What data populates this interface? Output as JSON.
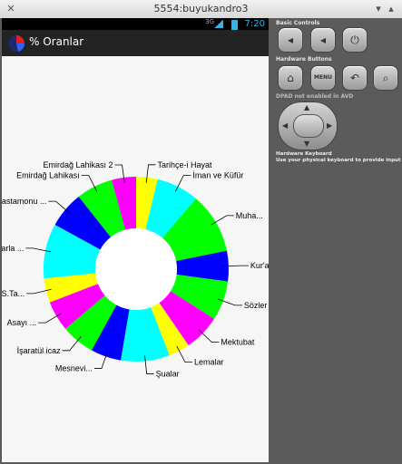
{
  "window": {
    "title": "5554:buyukandro3"
  },
  "statusbar": {
    "network": "3G",
    "time": "7:20"
  },
  "actionbar": {
    "title": "% Oranlar"
  },
  "chart_data": {
    "type": "pie",
    "donut": true,
    "slices": [
      {
        "label": "Tarihçe-i Hayat",
        "value": 3.5,
        "color": "#ffff00"
      },
      {
        "label": "İman ve Küfür",
        "value": 7,
        "color": "#00ffff"
      },
      {
        "label": "Muha...",
        "value": 10,
        "color": "#00ff00"
      },
      {
        "label": "Kur'a...",
        "value": 5,
        "color": "#0000ff"
      },
      {
        "label": "Sözler",
        "value": 6.5,
        "color": "#00ff00"
      },
      {
        "label": "Mektubat",
        "value": 6,
        "color": "#ff00ff"
      },
      {
        "label": "Lemalar",
        "value": 3.5,
        "color": "#ffff00"
      },
      {
        "label": "Şualar",
        "value": 8,
        "color": "#00ffff"
      },
      {
        "label": "Mesnevi...",
        "value": 5,
        "color": "#0000ff"
      },
      {
        "label": "İşaratül icaz",
        "value": 5.5,
        "color": "#00ff00"
      },
      {
        "label": "Asayı ...",
        "value": 5,
        "color": "#ff00ff"
      },
      {
        "label": "S.Ta...",
        "value": 4,
        "color": "#ffff00"
      },
      {
        "label": "Barla ...",
        "value": 9,
        "color": "#00ffff"
      },
      {
        "label": "Kastamonu ...",
        "value": 6,
        "color": "#0000ff"
      },
      {
        "label": "Emirdağ Lahikası",
        "value": 6,
        "color": "#00ff00"
      },
      {
        "label": "Emirdağ Lahikası 2",
        "value": 4,
        "color": "#ff00ff"
      }
    ]
  },
  "controls": {
    "basic_title": "Basic Controls",
    "hardware_title": "Hardware Buttons",
    "menu_label": "MENU",
    "dpad_title": "DPAD not enabled in AVD",
    "keyboard_title": "Hardware Keyboard",
    "keyboard_hint": "Use your physical keyboard to provide input"
  }
}
